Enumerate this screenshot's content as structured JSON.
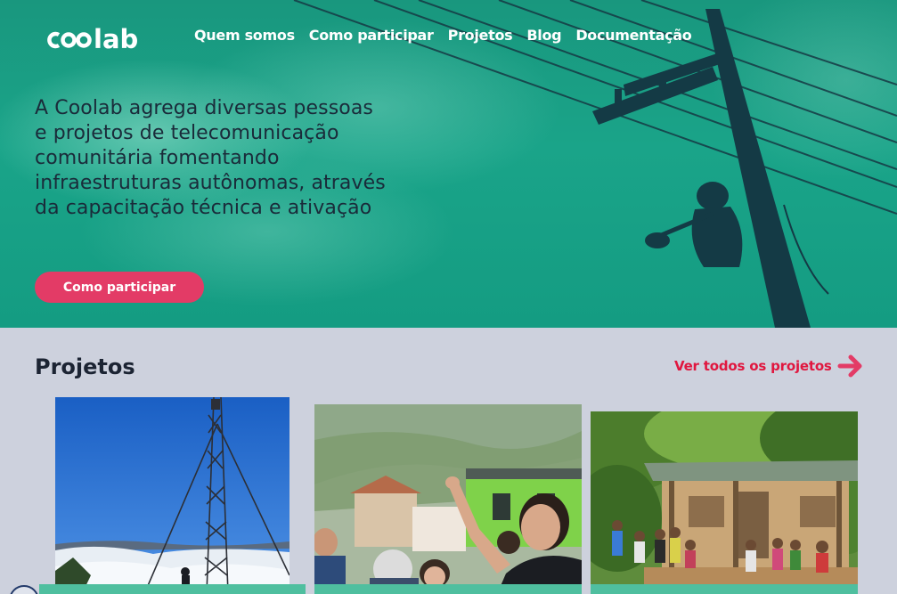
{
  "brand": {
    "logo_text": "coolab"
  },
  "nav": {
    "items": [
      {
        "label": "Quem somos"
      },
      {
        "label": "Como participar"
      },
      {
        "label": "Projetos"
      },
      {
        "label": "Blog"
      },
      {
        "label": "Documentação"
      }
    ]
  },
  "hero": {
    "headline_lines": [
      "A Coolab agrega diversas pessoas",
      "e projetos de telecomunicação",
      "comunitária fomentando",
      "infraestruturas autônomas, através",
      "da capacitação técnica e ativação"
    ],
    "cta_label": "Como participar"
  },
  "projects": {
    "title": "Projetos",
    "see_all_label": "Ver todos os projetos",
    "cards": [
      {
        "image": "radio-tower-photo"
      },
      {
        "image": "community-meeting-photo"
      },
      {
        "image": "village-house-photo"
      }
    ]
  },
  "colors": {
    "hero_teal": "#1aa489",
    "accent_pink": "#e33b66",
    "link_red": "#e0173f",
    "section_bg": "#cdd1dd"
  }
}
